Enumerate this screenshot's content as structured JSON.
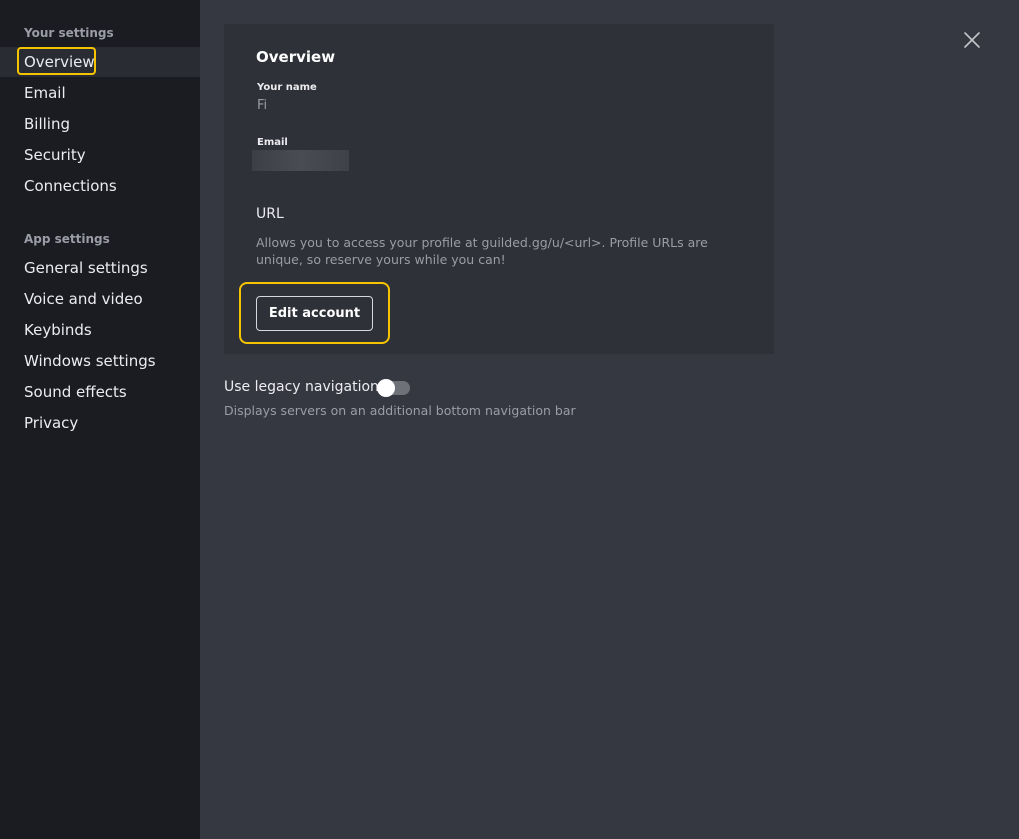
{
  "sidebar": {
    "your_settings_heading": "Your settings",
    "your_settings_items": [
      {
        "label": "Overview",
        "active": true
      },
      {
        "label": "Email"
      },
      {
        "label": "Billing"
      },
      {
        "label": "Security"
      },
      {
        "label": "Connections"
      }
    ],
    "app_settings_heading": "App settings",
    "app_settings_items": [
      {
        "label": "General settings"
      },
      {
        "label": "Voice and video"
      },
      {
        "label": "Keybinds"
      },
      {
        "label": "Windows settings"
      },
      {
        "label": "Sound effects"
      },
      {
        "label": "Privacy"
      }
    ]
  },
  "overview": {
    "title": "Overview",
    "name_label": "Your name",
    "name_value": "Fi",
    "email_label": "Email",
    "url_title": "URL",
    "url_description": "Allows you to access your profile at guilded.gg/u/<url>. Profile URLs are unique, so reserve yours while you can!",
    "edit_button_label": "Edit account"
  },
  "legacy_navigation": {
    "label": "Use legacy navigation",
    "description": "Displays servers on an additional bottom navigation bar",
    "enabled": false
  },
  "colors": {
    "highlight": "#f5c400",
    "sidebar_bg": "#1b1c21",
    "main_bg": "#363841",
    "card_bg": "#2f3138"
  }
}
